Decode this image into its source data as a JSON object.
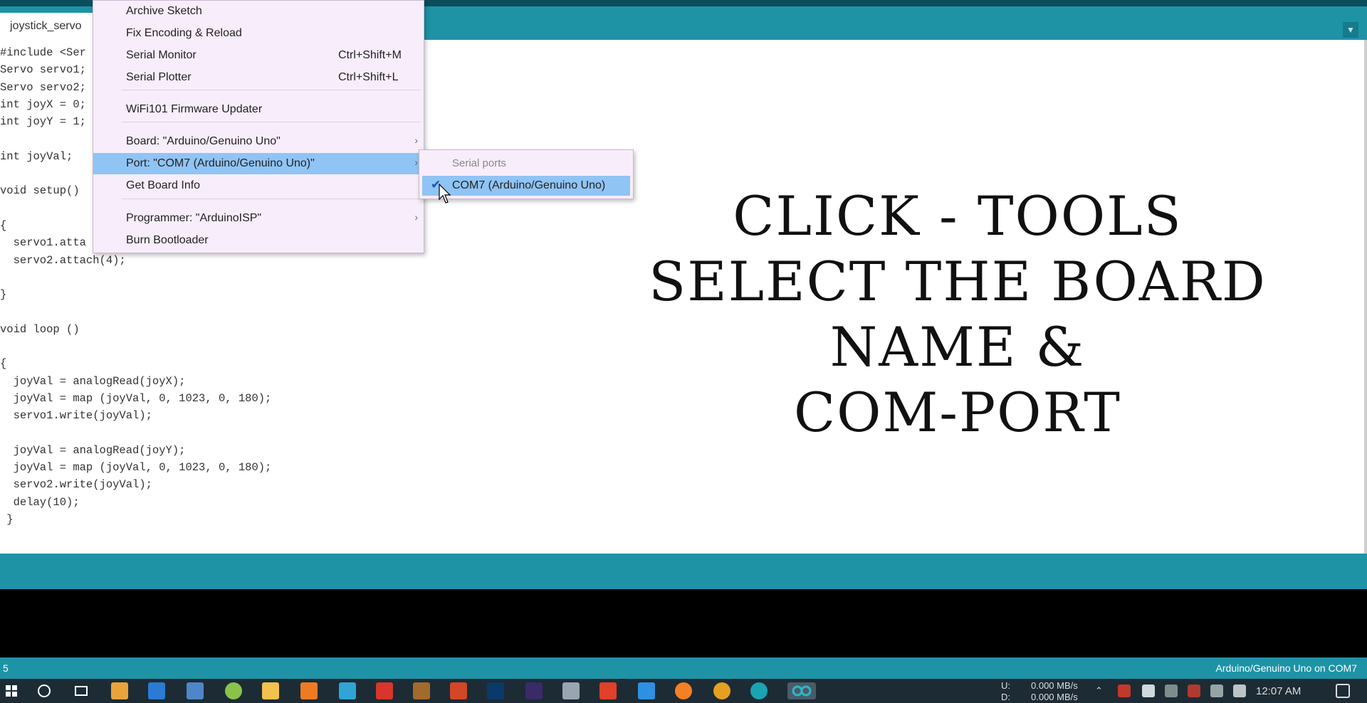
{
  "editor": {
    "tab_label": "joystick_servo",
    "code_lines": [
      "#include <Ser",
      "Servo servo1;",
      "Servo servo2;",
      "int joyX = 0;",
      "int joyY = 1;",
      "",
      "int joyVal;",
      "",
      "void setup()",
      "",
      "{",
      "  servo1.atta",
      "  servo2.attach(4);",
      "",
      "}",
      "",
      "void loop ()",
      "",
      "{",
      "  joyVal = analogRead(joyX);",
      "  joyVal = map (joyVal, 0, 1023, 0, 180);",
      "  servo1.write(joyVal);",
      "",
      "  joyVal = analogRead(joyY);",
      "  joyVal = map (joyVal, 0, 1023, 0, 180);",
      "  servo2.write(joyVal);",
      "  delay(10);",
      " }"
    ]
  },
  "overlay": {
    "line1": "CLICK - TOOLS",
    "line2": "SELECT THE BOARD",
    "line3": "NAME &",
    "line4": "COM-PORT"
  },
  "tools_menu": {
    "items": [
      {
        "label": "Archive Sketch",
        "shortcut": ""
      },
      {
        "label": "Fix Encoding & Reload",
        "shortcut": ""
      },
      {
        "label": "Serial Monitor",
        "shortcut": "Ctrl+Shift+M"
      },
      {
        "label": "Serial Plotter",
        "shortcut": "Ctrl+Shift+L"
      },
      {
        "label": "WiFi101 Firmware Updater",
        "shortcut": ""
      },
      {
        "label": "Board: \"Arduino/Genuino Uno\"",
        "submenu": true
      },
      {
        "label": "Port: \"COM7 (Arduino/Genuino Uno)\"",
        "submenu": true,
        "highlighted": true
      },
      {
        "label": "Get Board Info",
        "shortcut": ""
      },
      {
        "label": "Programmer: \"ArduinoISP\"",
        "submenu": true
      },
      {
        "label": "Burn Bootloader",
        "shortcut": ""
      }
    ]
  },
  "port_submenu": {
    "header": "Serial ports",
    "item": "COM7 (Arduino/Genuino Uno)",
    "checked": true
  },
  "status_bar": {
    "line_number": "5",
    "board_info": "Arduino/Genuino Uno on COM7"
  },
  "taskbar": {
    "net_up_label": "U:",
    "net_up": "0.000 MB/s",
    "net_down_label": "D:",
    "net_down": "0.000 MB/s",
    "clock": "12:07 AM"
  },
  "colors": {
    "arduino_teal": "#1e93a6",
    "menu_highlight": "#90c4f5",
    "menu_bg": "#f8eefb"
  }
}
